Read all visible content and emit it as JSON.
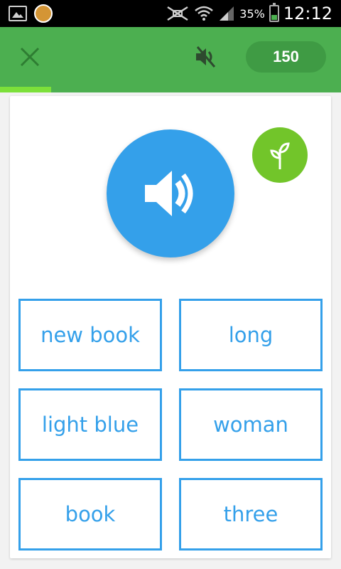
{
  "status_bar": {
    "time": "12:12",
    "battery_percent": "35%",
    "battery_level": 0.35,
    "icons": [
      "gallery-icon",
      "avatar",
      "mute-icon",
      "wifi-icon",
      "signal-icon",
      "battery-icon"
    ]
  },
  "top_bar": {
    "close_icon": "close-icon",
    "sound_icon": "sound-muted-icon",
    "score": "150",
    "colors": {
      "bar": "#4caf50",
      "pill": "#3f9b44"
    }
  },
  "progress": {
    "value": 0.15,
    "color": "#7ce03a"
  },
  "question": {
    "play_icon": "speaker-icon",
    "badge_icon": "sprout-icon",
    "accent": "#34a0ea"
  },
  "answers": [
    {
      "label": "new book"
    },
    {
      "label": "long"
    },
    {
      "label": "light blue"
    },
    {
      "label": "woman"
    },
    {
      "label": "book"
    },
    {
      "label": "three"
    }
  ]
}
